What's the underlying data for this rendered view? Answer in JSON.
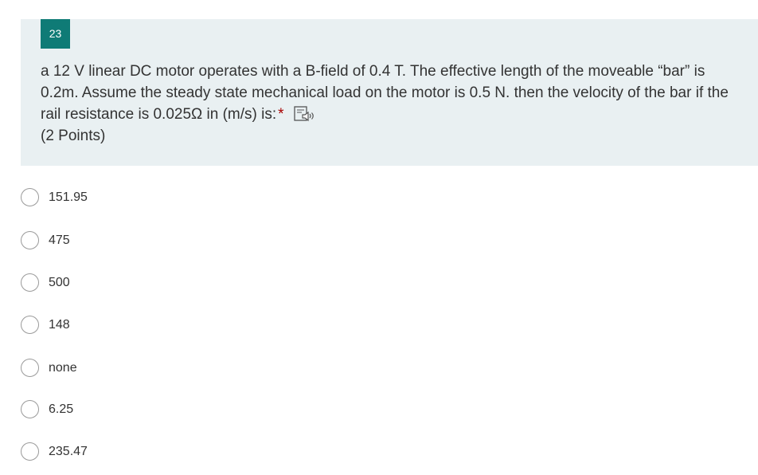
{
  "question": {
    "number": "23",
    "text": "a 12 V linear DC motor operates with a B-field of 0.4 T.  The effective length of the moveable “bar” is 0.2m.  Assume the steady state mechanical load on the motor is 0.5 N.  then the velocity of the bar if the rail resistance is 0.025Ω in (m/s) is:",
    "required_marker": "*",
    "points": "(2 Points)"
  },
  "options": [
    {
      "label": "151.95"
    },
    {
      "label": "475"
    },
    {
      "label": "500"
    },
    {
      "label": "148"
    },
    {
      "label": "none"
    },
    {
      "label": "6.25"
    },
    {
      "label": "235.47"
    }
  ],
  "colors": {
    "accent": "#0f7b76",
    "card_background": "#e9f0f2",
    "required": "#a80000"
  },
  "icons": {
    "immersive_reader": "speaker-icon"
  }
}
